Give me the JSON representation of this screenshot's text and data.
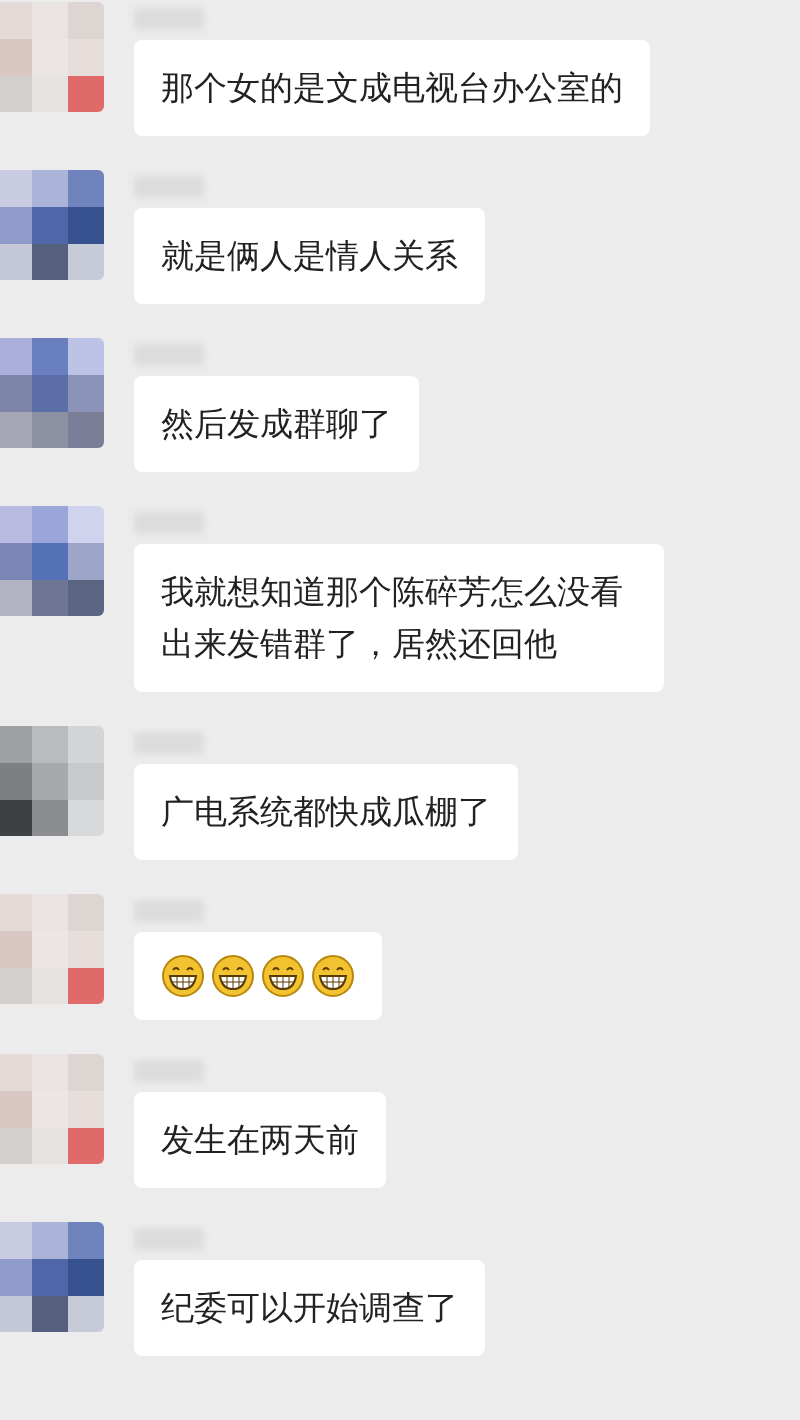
{
  "messages": [
    {
      "kind": "text",
      "text": "那个女的是文成电视台办公室的"
    },
    {
      "kind": "text",
      "text": "就是俩人是情人关系"
    },
    {
      "kind": "text",
      "text": "然后发成群聊了"
    },
    {
      "kind": "text",
      "text": "我就想知道那个陈碎芳怎么没看出来发错群了，居然还回他"
    },
    {
      "kind": "text",
      "text": "广电系统都快成瓜棚了"
    },
    {
      "kind": "emoji",
      "items": [
        {
          "kind": "grin"
        },
        {
          "kind": "grin"
        },
        {
          "kind": "grin"
        },
        {
          "kind": "grin"
        }
      ]
    },
    {
      "kind": "text",
      "text": "发生在两天前"
    },
    {
      "kind": "text",
      "text": "纪委可以开始调查了"
    }
  ]
}
